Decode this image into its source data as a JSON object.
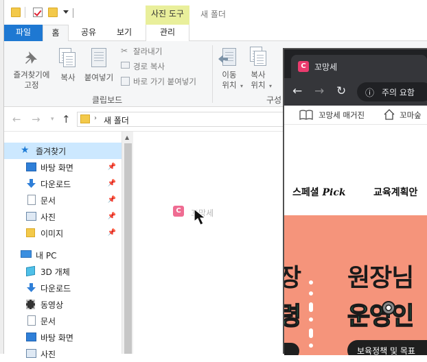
{
  "explorer": {
    "window_title": "새 폴더",
    "contextual_tab_group": "사진 도구",
    "tabs": {
      "file": "파일",
      "home": "홈",
      "share": "공유",
      "view": "보기",
      "manage": "관리"
    },
    "ribbon": {
      "pin_label_line1": "즐겨찾기에",
      "pin_label_line2": "고정",
      "copy": "복사",
      "paste": "붙여넣기",
      "cut": "잘라내기",
      "copy_path": "경로 복사",
      "paste_shortcut": "바로 가기 붙여넣기",
      "clipboard_group": "클립보드",
      "move_to_line1": "이동",
      "move_to_line2": "위치",
      "copy_to_line1": "복사",
      "copy_to_line2": "위치",
      "organize_group": "구성"
    },
    "address": {
      "path": "새 폴더"
    },
    "nav_pane": {
      "quick_access": "즐겨찾기",
      "items": [
        {
          "label": "바탕 화면",
          "icon": "desktop-icon",
          "pinned": true
        },
        {
          "label": "다운로드",
          "icon": "download-arrow-icon",
          "pinned": true
        },
        {
          "label": "문서",
          "icon": "document-icon",
          "pinned": true
        },
        {
          "label": "사진",
          "icon": "pictures-icon",
          "pinned": true
        },
        {
          "label": "이미지",
          "icon": "folder-icon",
          "pinned": true
        }
      ],
      "this_pc": "내 PC",
      "pc_items": [
        {
          "label": "3D 개체",
          "icon": "3d-objects-icon"
        },
        {
          "label": "다운로드",
          "icon": "download-arrow-icon"
        },
        {
          "label": "동영상",
          "icon": "video-icon"
        },
        {
          "label": "문서",
          "icon": "document-icon"
        },
        {
          "label": "바탕 화면",
          "icon": "desktop-icon"
        },
        {
          "label": "사진",
          "icon": "pictures-icon"
        }
      ]
    }
  },
  "drag_ghost": {
    "label": "꼬망세",
    "icon": "C"
  },
  "chrome": {
    "tab_title": "꼬망세",
    "favicon": "C",
    "security_label": "주의 요함",
    "bookmarks": [
      "꼬망세 매거진",
      "꼬마숲"
    ],
    "web": {
      "menu_special": "스페셜",
      "menu_pick": "Pick",
      "menu_education": "교육계획안",
      "banner_big_left_1": "장",
      "banner_big_left_2": "령",
      "banner_big_right_1": "원장님",
      "banner_big_right_2": "운영인",
      "banner_pill": "보육정책 및 목표"
    }
  },
  "colors": {
    "file_tab": "#1e78d2",
    "photo_tools": "#e9ef9b",
    "banner": "#f5947b",
    "banner_green": "#25c48a",
    "chrome_dark": "#202124",
    "favicon": "#ea3b6e"
  }
}
